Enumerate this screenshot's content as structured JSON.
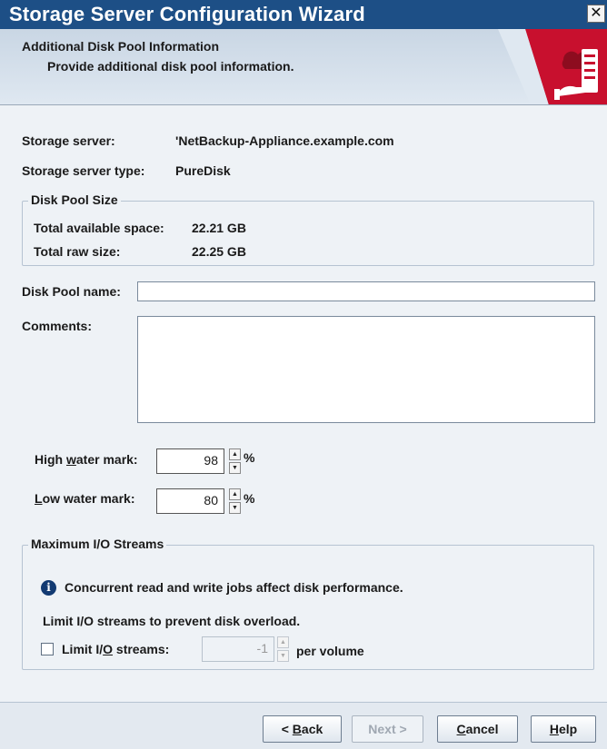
{
  "window": {
    "title": "Storage Server Configuration Wizard",
    "close_glyph": "✕"
  },
  "header": {
    "title": "Additional Disk Pool Information",
    "subtitle": "Provide additional disk pool information."
  },
  "storage_server": {
    "label": "Storage server:",
    "value": "'NetBackup-Appliance.example.com"
  },
  "storage_server_type": {
    "label": "Storage server type:",
    "value": "PureDisk"
  },
  "disk_pool_size": {
    "legend": "Disk Pool Size",
    "total_available_label": "Total available space:",
    "total_available_value": "22.21 GB",
    "total_raw_label": "Total raw size:",
    "total_raw_value": "22.25 GB"
  },
  "disk_pool_name": {
    "label": "Disk Pool name:",
    "value": ""
  },
  "comments": {
    "label": "Comments:",
    "value": ""
  },
  "high_water_mark": {
    "label_pre": "High ",
    "label_mnemonic": "w",
    "label_post": "ater mark:",
    "value": "98",
    "unit": "%"
  },
  "low_water_mark": {
    "label_pre": "",
    "label_mnemonic": "L",
    "label_post": "ow water mark:",
    "value": "80",
    "unit": "%"
  },
  "max_io_streams": {
    "legend": "Maximum I/O Streams",
    "info_glyph": "i",
    "info_text": "Concurrent read and write jobs affect disk performance.",
    "hint_text": "Limit I/O streams to prevent disk overload.",
    "limit_label_pre": "Limit I/",
    "limit_label_mnemonic": "O",
    "limit_label_post": " streams:",
    "limit_checked": false,
    "limit_value": "-1",
    "per_volume": "per volume"
  },
  "spinner_glyphs": {
    "up": "▲",
    "down": "▼"
  },
  "buttons": {
    "back": {
      "pre": "< ",
      "mnemonic": "B",
      "post": "ack"
    },
    "next": {
      "pre": "",
      "mnemonic": "",
      "post": "Next >"
    },
    "cancel": {
      "pre": "",
      "mnemonic": "C",
      "post": "ancel"
    },
    "help": {
      "pre": "",
      "mnemonic": "H",
      "post": "elp"
    }
  },
  "colors": {
    "title_bar": "#1d4f86",
    "logo_red": "#c8102e",
    "logo_dark": "#8d0c1f",
    "info_icon": "#123a72"
  }
}
